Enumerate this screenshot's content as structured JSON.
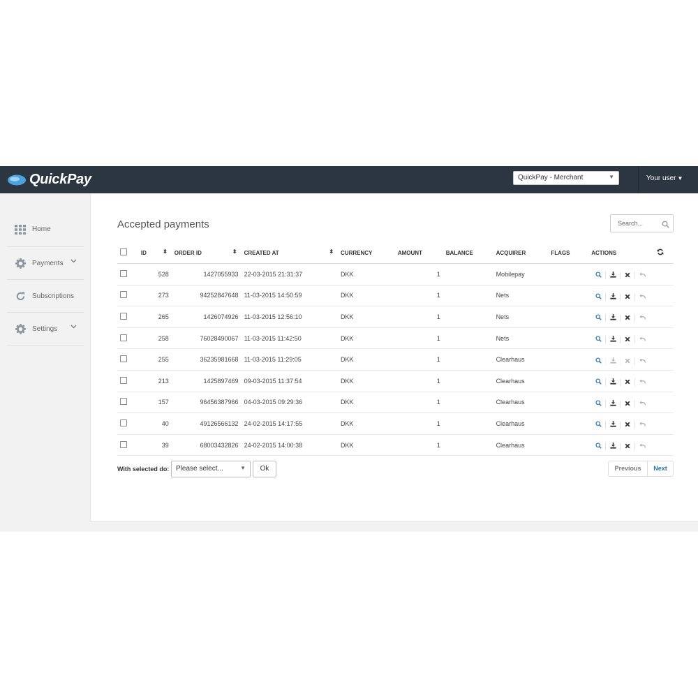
{
  "topbar": {
    "logo_text": "QuickPay",
    "merchant_select": "QuickPay - Merchant",
    "user_menu": "Your user"
  },
  "sidebar": {
    "items": [
      {
        "label": "Home",
        "icon": "grid-icon"
      },
      {
        "label": "Payments",
        "icon": "gear-icon",
        "has_chevron": true
      },
      {
        "label": "Subscriptions",
        "icon": "refresh-icon"
      },
      {
        "label": "Settings",
        "icon": "gear-icon",
        "has_chevron": true
      }
    ]
  },
  "main": {
    "title": "Accepted payments",
    "search_placeholder": "Search...",
    "columns": [
      "ID",
      "ORDER ID",
      "CREATED AT",
      "CURRENCY",
      "AMOUNT",
      "BALANCE",
      "ACQUIRER",
      "FLAGS",
      "ACTIONS"
    ],
    "rows": [
      {
        "id": "528",
        "order_id": "1427055933",
        "created_at": "22-03-2015 21:31:37",
        "currency": "DKK",
        "amount": "1",
        "balance": "",
        "acquirer": "Mobilepay",
        "flags": ""
      },
      {
        "id": "273",
        "order_id": "94252847648",
        "created_at": "11-03-2015 14:50:59",
        "currency": "DKK",
        "amount": "1",
        "balance": "",
        "acquirer": "Nets",
        "flags": ""
      },
      {
        "id": "265",
        "order_id": "1426074926",
        "created_at": "11-03-2015 12:56:10",
        "currency": "DKK",
        "amount": "1",
        "balance": "",
        "acquirer": "Nets",
        "flags": ""
      },
      {
        "id": "258",
        "order_id": "76028490067",
        "created_at": "11-03-2015 11:42:50",
        "currency": "DKK",
        "amount": "1",
        "balance": "",
        "acquirer": "Nets",
        "flags": ""
      },
      {
        "id": "255",
        "order_id": "36235981668",
        "created_at": "11-03-2015 11:29:05",
        "currency": "DKK",
        "amount": "1",
        "balance": "",
        "acquirer": "Clearhaus",
        "flags": ""
      },
      {
        "id": "213",
        "order_id": "1425897469",
        "created_at": "09-03-2015 11:37:54",
        "currency": "DKK",
        "amount": "1",
        "balance": "",
        "acquirer": "Clearhaus",
        "flags": ""
      },
      {
        "id": "157",
        "order_id": "96456387966",
        "created_at": "04-03-2015 09:29:36",
        "currency": "DKK",
        "amount": "1",
        "balance": "",
        "acquirer": "Clearhaus",
        "flags": ""
      },
      {
        "id": "40",
        "order_id": "49126566132",
        "created_at": "24-02-2015 14:17:55",
        "currency": "DKK",
        "amount": "1",
        "balance": "",
        "acquirer": "Clearhaus",
        "flags": ""
      },
      {
        "id": "39",
        "order_id": "68003432826",
        "created_at": "24-02-2015 14:00:38",
        "currency": "DKK",
        "amount": "1",
        "balance": "",
        "acquirer": "Clearhaus",
        "flags": ""
      }
    ],
    "bulk_label": "With selected do:",
    "bulk_select": "Please select...",
    "ok_label": "Ok",
    "pager": {
      "previous": "Previous",
      "next": "Next"
    }
  },
  "colors": {
    "topbar": "#2b3640",
    "accent": "#2a73a8",
    "logo": "#4aa3df"
  }
}
